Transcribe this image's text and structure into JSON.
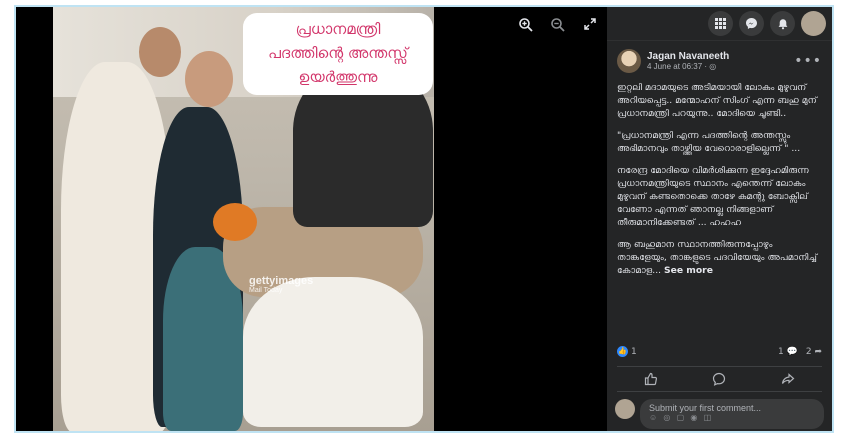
{
  "image": {
    "overlay_title_lines": [
      "പ്രധാനമന്ത്രി",
      "പദത്തിന്റെ അന്തസ്സ്",
      "ഉയർത്തുന്നു"
    ],
    "watermark": "gettyimages",
    "watermark_sub": "Mail Today"
  },
  "viewer": {
    "zoom_in_icon": "zoom-in-icon",
    "zoom_out_icon": "zoom-out-icon",
    "fullscreen_icon": "fullscreen-icon"
  },
  "topbar": {
    "menu_icon": "grid-menu-icon",
    "messenger_icon": "messenger-icon",
    "notifications_icon": "bell-icon"
  },
  "post": {
    "author": "Jagan Navaneeth",
    "time": "4 June at 06:37 · ◎",
    "paragraphs": [
      "ഇറ്റലി മദാമയുടെ അടിമയായി ലോകം മുഴുവന് അറിയപ്പെട്ട.. മന്മോഹന് സിംഗ് എന്ന ബഹു മുന് പ്രധാനമന്ത്രി പറയുന്നു.. മോദിയെ ചൂണ്ടി..",
      "\"പ്രധാനമന്ത്രി എന്ന പദത്തിന്റെ അന്തസ്സും അഭിമാനവും താഴ്ത്തിയ വേറൊരാളില്ലെന്ന് \" ...",
      "നരേന്ദ്ര മോദിയെ വിമർശിക്കുന്ന ഇദ്ദേഹമിരുന്ന പ്രധാനമന്ത്രിയുടെ സ്ഥാനം എന്തെന്ന് ലോകം മുഴുവന് കണ്ടതൊക്കെ താഴേ കമന്റു ബോക്സില് വേണോ എന്നത് ഞാനല്ല നിങ്ങളാണ് തീരുമാനിക്കേണ്ടത് ... ഹഹഹ",
      "ആ ബഹുമാന സ്ഥാനത്തിരുന്നപ്പോഴും താങ്കളേയും, താങ്കളുടെ പദവിയേയും അപമാനിച്ച് കോമാള..."
    ],
    "see_more": "See more",
    "like_count": "1",
    "comment_count": "1",
    "share_count": "2",
    "comment_placeholder": "Submit your first comment..."
  }
}
